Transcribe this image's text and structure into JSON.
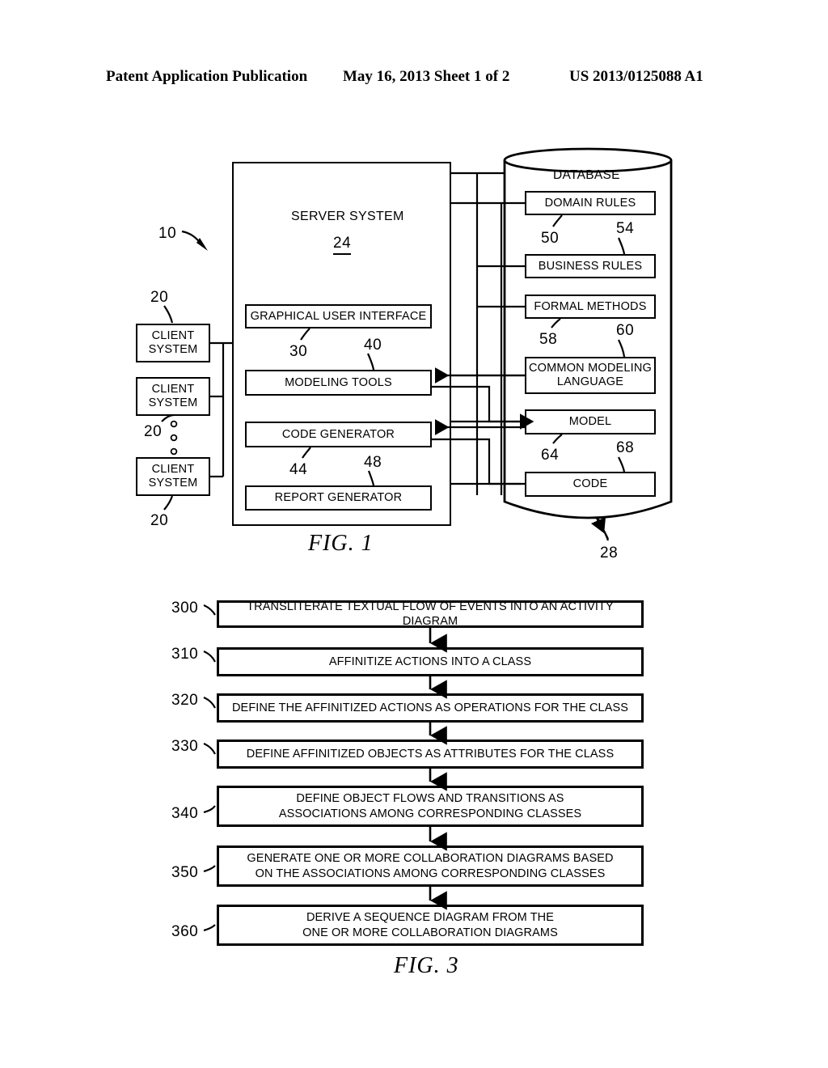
{
  "header": {
    "left": "Patent Application Publication",
    "middle": "May 16, 2013  Sheet 1 of 2",
    "right": "US 2013/0125088 A1"
  },
  "fig1": {
    "caption": "FIG. 1",
    "system_ref": "10",
    "clients": [
      {
        "label": "CLIENT\nSYSTEM",
        "ref": "20"
      },
      {
        "label": "CLIENT\nSYSTEM",
        "ref": "20"
      },
      {
        "label": "CLIENT\nSYSTEM",
        "ref": "20"
      }
    ],
    "client_label_line1": "CLIENT",
    "client_label_line2": "SYSTEM",
    "server": {
      "title": "SERVER SYSTEM",
      "ref": "24",
      "modules": [
        {
          "label": "GRAPHICAL USER INTERFACE",
          "ref": "30"
        },
        {
          "label": "MODELING TOOLS",
          "ref": "40"
        },
        {
          "label": "CODE GENERATOR",
          "ref": "44"
        },
        {
          "label": "REPORT GENERATOR",
          "ref": "48"
        }
      ]
    },
    "database": {
      "title": "DATABASE",
      "ref": "28",
      "items": [
        {
          "label": "DOMAIN RULES",
          "ref": "50"
        },
        {
          "label": "BUSINESS RULES",
          "ref": "54"
        },
        {
          "label": "FORMAL METHODS",
          "ref": "58"
        },
        {
          "label": "COMMON MODELING\nLANGUAGE",
          "ref": "60"
        },
        {
          "label": "MODEL",
          "ref": "64"
        },
        {
          "label": "CODE",
          "ref": "68"
        }
      ],
      "cml_line1": "COMMON MODELING",
      "cml_line2": "LANGUAGE"
    }
  },
  "fig3": {
    "caption": "FIG. 3",
    "steps": [
      {
        "ref": "300",
        "text": "TRANSLITERATE TEXTUAL FLOW OF EVENTS INTO AN ACTIVITY DIAGRAM"
      },
      {
        "ref": "310",
        "text": "AFFINITIZE ACTIONS INTO A CLASS"
      },
      {
        "ref": "320",
        "text": "DEFINE THE AFFINITIZED ACTIONS AS OPERATIONS FOR THE CLASS"
      },
      {
        "ref": "330",
        "text": "DEFINE AFFINITIZED OBJECTS AS ATTRIBUTES FOR THE CLASS"
      },
      {
        "ref": "340",
        "text": "DEFINE OBJECT FLOWS AND TRANSITIONS AS\nASSOCIATIONS AMONG CORRESPONDING CLASSES"
      },
      {
        "ref": "350",
        "text": "GENERATE ONE OR MORE COLLABORATION DIAGRAMS BASED\nON THE ASSOCIATIONS AMONG CORRESPONDING CLASSES"
      },
      {
        "ref": "360",
        "text": "DERIVE A SEQUENCE DIAGRAM FROM THE\nONE OR MORE COLLABORATION DIAGRAMS"
      }
    ]
  },
  "colors": {
    "ink": "#000000",
    "paper": "#ffffff"
  }
}
